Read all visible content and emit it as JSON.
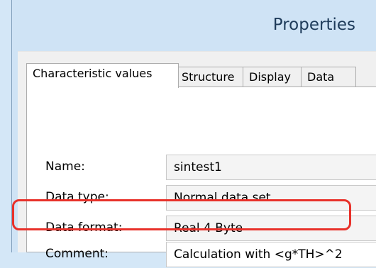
{
  "window": {
    "title": "Properties"
  },
  "tabs": [
    {
      "label": "Characteristic values",
      "active": true
    },
    {
      "label": "Structure",
      "active": false
    },
    {
      "label": "Display",
      "active": false
    },
    {
      "label": "Data",
      "active": false
    }
  ],
  "fields": {
    "name": {
      "label": "Name:",
      "value": "sintest1"
    },
    "data_type": {
      "label": "Data type:",
      "value": "Normal data set"
    },
    "data_format": {
      "label": "Data format:",
      "value": "Real 4 Byte"
    },
    "comment": {
      "label": "Comment:",
      "value": "Calculation with <g*TH>^2"
    }
  },
  "colors": {
    "highlight": "#e8312a"
  }
}
